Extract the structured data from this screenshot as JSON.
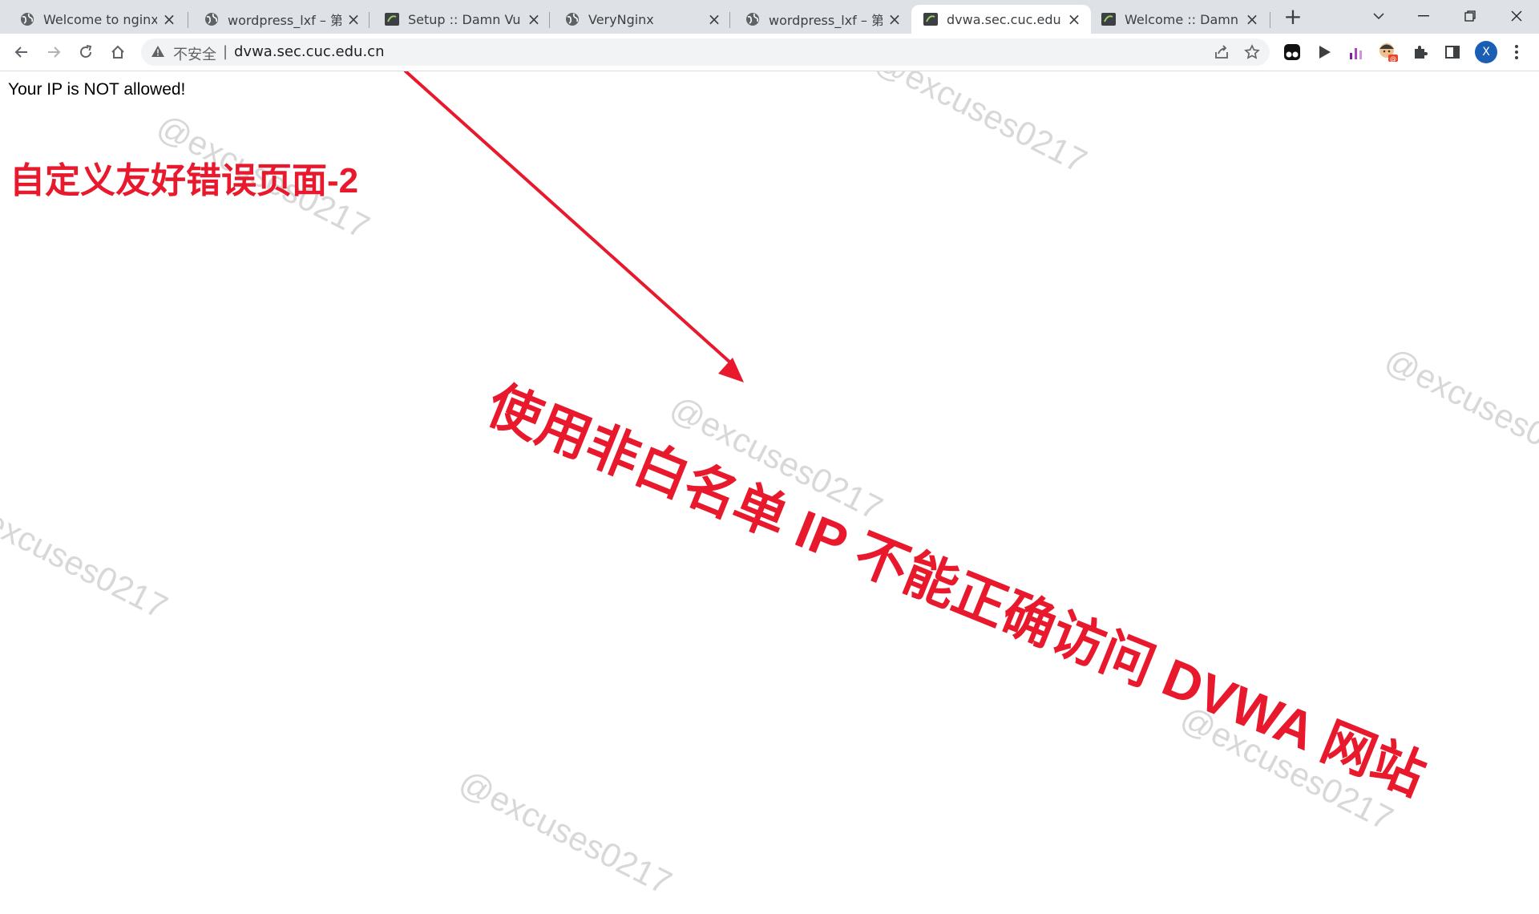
{
  "tabs": [
    {
      "title": "Welcome to nginx!",
      "icon": "globe-icon"
    },
    {
      "title": "wordpress_lxf – 第五",
      "icon": "globe-icon"
    },
    {
      "title": "Setup :: Damn Vulne",
      "icon": "dvwa-icon"
    },
    {
      "title": "VeryNginx",
      "icon": "globe-icon"
    },
    {
      "title": "wordpress_lxf – 第五",
      "icon": "globe-icon"
    },
    {
      "title": "dvwa.sec.cuc.edu.cn",
      "icon": "dvwa-icon",
      "active": true
    },
    {
      "title": "Welcome :: Damn Vu",
      "icon": "dvwa-icon"
    }
  ],
  "address_bar": {
    "security_label": "不安全",
    "url": "dvwa.sec.cuc.edu.cn"
  },
  "profile": {
    "initial": "X",
    "color": "#1a5fb4"
  },
  "page": {
    "message": "Your IP is NOT allowed!"
  },
  "annotations": {
    "title": "自定义友好错误页面-2",
    "note": "使用非白名单 IP 不能正确访问 DVWA 网站",
    "color": "#e8192c"
  },
  "watermark": "@excuses0217"
}
